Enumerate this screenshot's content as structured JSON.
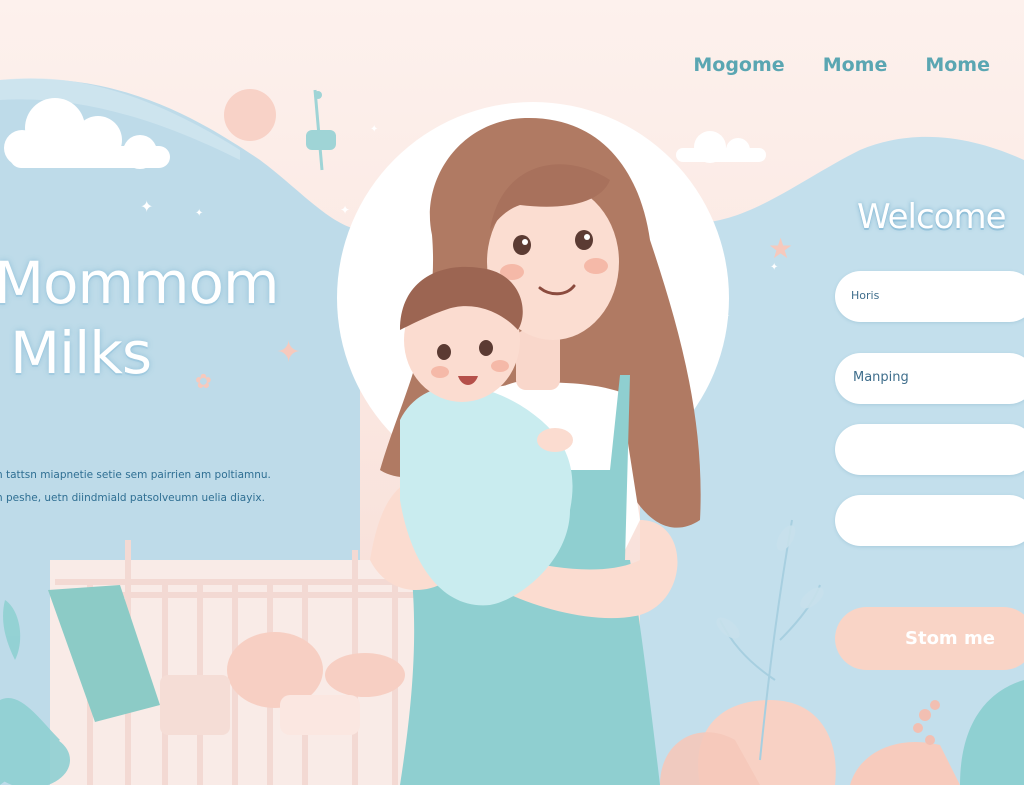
{
  "nav": {
    "items": [
      "Mogome",
      "Mome",
      "Mome"
    ]
  },
  "hero": {
    "title_line1": "Mommom",
    "title_line2": "Milks",
    "description_line1": "n tattsn miapnetie setie sem pairrien am poltiamnu.",
    "description_line2": "n peshe, uetn diindmiald patsolveumn uelia diayix."
  },
  "form": {
    "welcome": "Welcome",
    "field1_label": "Horis",
    "field2_label": "Manping",
    "submit_label": "Stom me"
  },
  "colors": {
    "sky_blue": "#bfdbe9",
    "peach": "#f8d2c5",
    "teal": "#8fcfd0",
    "nav_text": "#5aa6b2"
  }
}
